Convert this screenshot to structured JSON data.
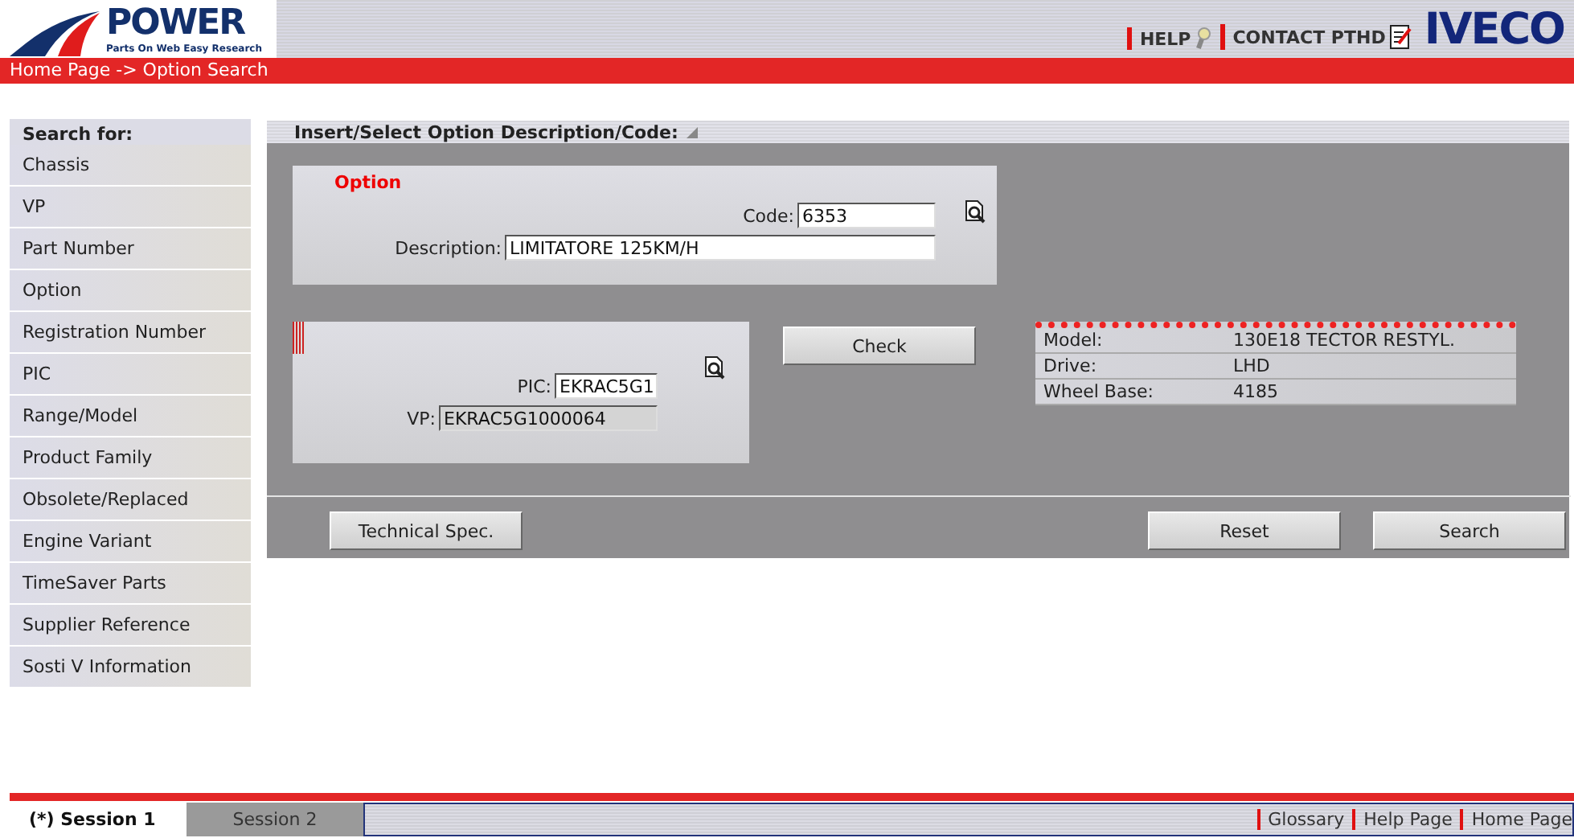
{
  "header": {
    "logo_title": "POWER",
    "logo_subtitle": "Parts On Web Easy Research",
    "links": [
      "HELP",
      "CONTACT PTHD"
    ],
    "brand": "IVECO"
  },
  "breadcrumb": "Home Page -> Option Search",
  "sidebar": {
    "title": "Search for:",
    "items": [
      {
        "label": "Chassis"
      },
      {
        "label": "VP"
      },
      {
        "label": "Part Number"
      },
      {
        "label": "Option"
      },
      {
        "label": "Registration Number"
      },
      {
        "label": "PIC"
      },
      {
        "label": "Range/Model"
      },
      {
        "label": "Product Family"
      },
      {
        "label": "Obsolete/Replaced"
      },
      {
        "label": "Engine Variant"
      },
      {
        "label": "TimeSaver Parts"
      },
      {
        "label": "Supplier Reference"
      },
      {
        "label": "Sosti V Information"
      }
    ]
  },
  "main": {
    "title": "Insert/Select Option Description/Code:",
    "option_panel": {
      "title": "Option",
      "fields": [
        {
          "label": "Code:",
          "value": "6353",
          "readonly": false
        },
        {
          "label": "Description:",
          "value": "LIMITATORE 125KM/H",
          "readonly": false
        }
      ]
    },
    "vehicle_panel": {
      "fields": [
        {
          "label": "PIC:",
          "value": "EKRAC5G1",
          "readonly": false
        },
        {
          "label": "VP:",
          "value": "EKRAC5G1000064",
          "readonly": true
        }
      ]
    },
    "check_button": "Check",
    "vehicle_info": [
      {
        "label": "Model:",
        "value": "130E18 TECTOR RESTYL."
      },
      {
        "label": "Drive:",
        "value": "LHD"
      },
      {
        "label": "Wheel Base:",
        "value": "4185"
      }
    ],
    "buttons": [
      "Technical Spec.",
      "Reset",
      "Search"
    ]
  },
  "footer": {
    "sessions": [
      {
        "label": "(*) Session 1",
        "selected": true
      },
      {
        "label": "Session 2",
        "selected": false
      }
    ],
    "links": [
      "Glossary",
      "Help Page",
      "Home Page"
    ]
  }
}
